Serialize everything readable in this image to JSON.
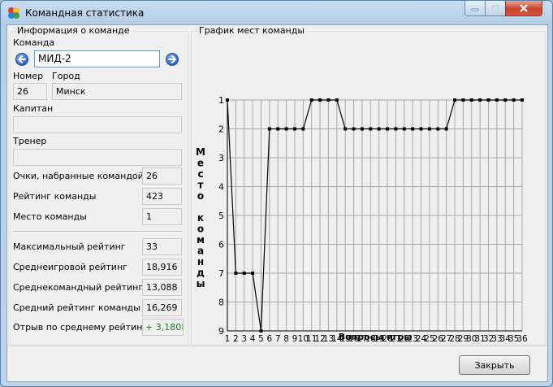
{
  "window": {
    "title": "Командная статистика"
  },
  "info": {
    "legend": "Информация о команде",
    "team_label": "Команда",
    "team_value": "МИД-2",
    "number_label": "Номер",
    "number_value": "26",
    "city_label": "Город",
    "city_value": "Минск",
    "captain_label": "Капитан",
    "captain_value": "",
    "coach_label": "Тренер",
    "coach_value": "",
    "points_label": "Очки, набранные командой",
    "points_value": "26",
    "rating_label": "Рейтинг команды",
    "rating_value": "423",
    "place_label": "Место команды",
    "place_value": "1",
    "max_rating_label": "Максимальный рейтинг",
    "max_rating_value": "33",
    "avg_game_label": "Среднеигровой рейтинг",
    "avg_game_value": "18,916",
    "avg_team_label": "Среднекомандный рейтинг",
    "avg_team_value": "13,088",
    "avg_rating_label": "Средний рейтинг команды",
    "avg_rating_value": "16,269",
    "gap_label": "Отрыв по среднему рейтингу",
    "gap_value": "+ 3,1808"
  },
  "chart_panel": {
    "legend": "График мест команды"
  },
  "buttons": {
    "close_label": "Закрыть"
  },
  "icons": {
    "app": "app-icon",
    "prev": "arrow-left-icon",
    "next": "arrow-right-icon",
    "minimize": "minimize-icon",
    "maximize": "maximize-icon",
    "close": "close-icon"
  },
  "colors": {
    "green_text": "#1e7d1e",
    "close_button_red": "#c8452d",
    "line": "#000000"
  },
  "chart_data": {
    "type": "line",
    "title": "",
    "xlabel": "Вопросы игры",
    "ylabel": "Место команды",
    "categories": [
      "1",
      "2",
      "3",
      "4",
      "5",
      "6",
      "7",
      "8",
      "9",
      "10",
      "11",
      "12",
      "13",
      "14",
      "15",
      "16",
      "17",
      "18",
      "19",
      "20",
      "21",
      "22",
      "23",
      "24",
      "25",
      "26",
      "27",
      "28",
      "29",
      "30",
      "31",
      "32",
      "33",
      "34",
      "35",
      "36"
    ],
    "values": [
      1,
      7,
      7,
      7,
      9,
      2,
      2,
      2,
      2,
      2,
      1,
      1,
      1,
      1,
      2,
      2,
      2,
      2,
      2,
      2,
      2,
      2,
      2,
      2,
      2,
      2,
      2,
      1,
      1,
      1,
      1,
      1,
      1,
      1,
      1,
      1
    ],
    "ylim": [
      1,
      9
    ],
    "y_inverted": true,
    "yticks": [
      1,
      2,
      3,
      4,
      5,
      6,
      7,
      8,
      9
    ],
    "grid": true,
    "legend": "none"
  }
}
